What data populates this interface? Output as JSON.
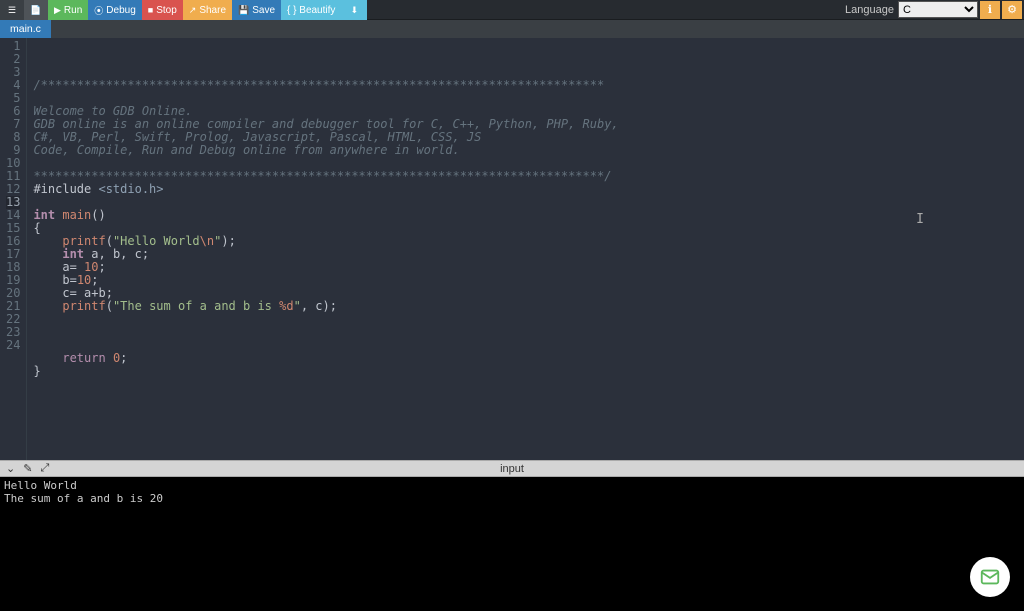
{
  "toolbar": {
    "run": "Run",
    "debug": "Debug",
    "stop": "Stop",
    "share": "Share",
    "save": "Save",
    "beautify": "{ } Beautify",
    "language_label": "Language",
    "language_value": "C"
  },
  "tabs": {
    "active": "main.c"
  },
  "editor": {
    "lines": [
      {
        "n": 1,
        "t": "comment",
        "text": "/******************************************************************************"
      },
      {
        "n": 2,
        "t": "comment",
        "text": ""
      },
      {
        "n": 3,
        "t": "comment",
        "text": "Welcome to GDB Online."
      },
      {
        "n": 4,
        "t": "comment",
        "text": "GDB online is an online compiler and debugger tool for C, C++, Python, PHP, Ruby, "
      },
      {
        "n": 5,
        "t": "comment",
        "text": "C#, VB, Perl, Swift, Prolog, Javascript, Pascal, HTML, CSS, JS"
      },
      {
        "n": 6,
        "t": "comment",
        "text": "Code, Compile, Run and Debug online from anywhere in world."
      },
      {
        "n": 7,
        "t": "comment",
        "text": ""
      },
      {
        "n": 8,
        "t": "comment",
        "text": "*******************************************************************************/"
      },
      {
        "n": 9,
        "t": "include",
        "pre": "#include ",
        "hdr": "<stdio.h>"
      },
      {
        "n": 10,
        "t": "blank"
      },
      {
        "n": 11,
        "t": "sig",
        "kw": "int ",
        "fn": "main",
        "after": "()"
      },
      {
        "n": 12,
        "t": "brace",
        "text": "{"
      },
      {
        "n": 13,
        "t": "printf",
        "indent": "    ",
        "fn": "printf",
        "open": "(",
        "s1": "\"Hello World",
        "esc": "\\n",
        "s2": "\"",
        "close": ");",
        "active": true
      },
      {
        "n": 14,
        "t": "decl",
        "indent": "    ",
        "kw": "int ",
        "rest": "a, b, c;"
      },
      {
        "n": 15,
        "t": "assign",
        "indent": "    ",
        "lhs": "a",
        "op": "= ",
        "num": "10",
        "semi": ";"
      },
      {
        "n": 16,
        "t": "assign",
        "indent": "    ",
        "lhs": "b",
        "op": "=",
        "num": "10",
        "semi": ";"
      },
      {
        "n": 17,
        "t": "expr",
        "indent": "    ",
        "text_pre": "c",
        "op1": "= ",
        "text_mid": "a",
        "op2": "+",
        "text_post": "b;"
      },
      {
        "n": 18,
        "t": "printf2",
        "indent": "    ",
        "fn": "printf",
        "open": "(",
        "s1": "\"The sum of a and b is ",
        "fmt": "%d",
        "s2": "\"",
        "args": ", c);"
      },
      {
        "n": 19,
        "t": "blank"
      },
      {
        "n": 20,
        "t": "blank"
      },
      {
        "n": 21,
        "t": "blank"
      },
      {
        "n": 22,
        "t": "return",
        "indent": "    ",
        "kw": "return ",
        "num": "0",
        "semi": ";"
      },
      {
        "n": 23,
        "t": "brace",
        "text": "}"
      },
      {
        "n": 24,
        "t": "blank"
      }
    ]
  },
  "consoleBar": {
    "center": "input"
  },
  "console": {
    "line1": "Hello World",
    "line2": "The sum of a and b is 20"
  }
}
